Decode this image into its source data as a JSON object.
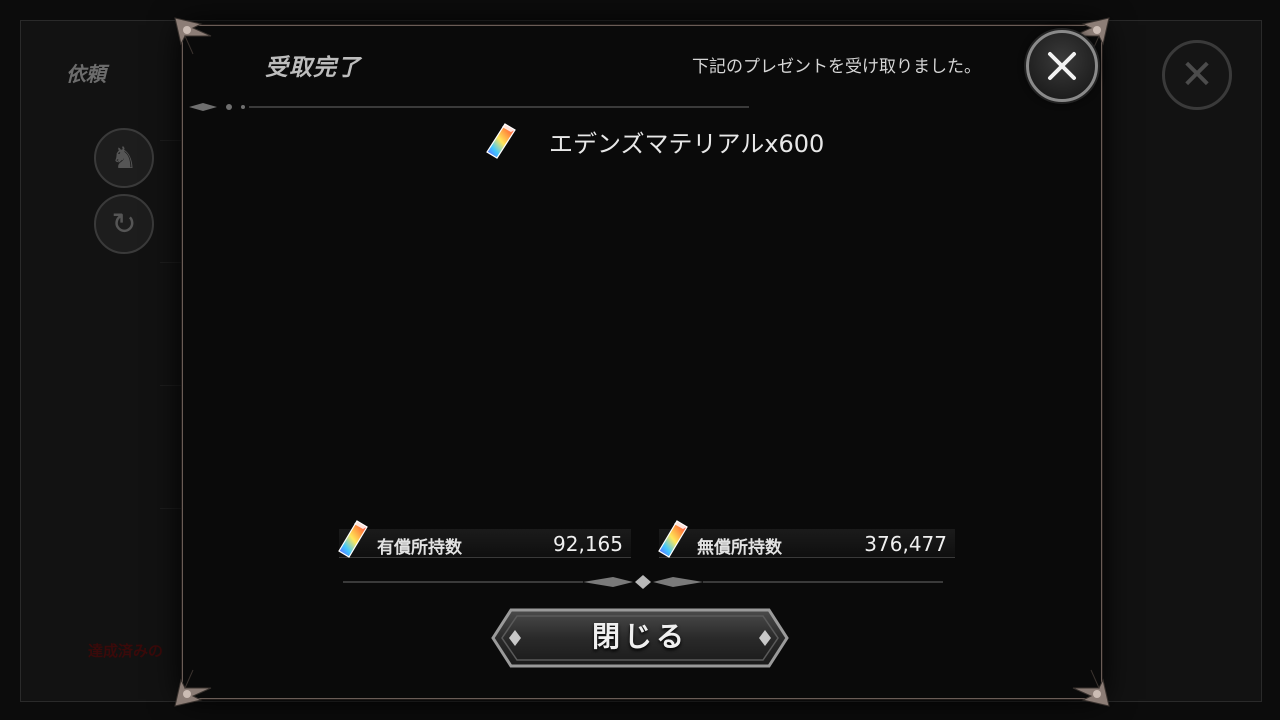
{
  "background": {
    "screen_title": "依頼",
    "footer_text": "達成済みの"
  },
  "dialog": {
    "title": "受取完了",
    "subtitle": "下記のプレゼントを受け取りました。",
    "close_icon": "close-x-icon",
    "reward": {
      "icon": "crystal-gem-icon",
      "text": "エデンズマテリアルx600"
    },
    "paid_count": {
      "label": "有償所持数",
      "value": "92,165"
    },
    "free_count": {
      "label": "無償所持数",
      "value": "376,477"
    },
    "ok_button": {
      "label": "閉じる"
    }
  },
  "colors": {
    "dialog_bg": "#0a0a0a",
    "frame": "#6a5c56",
    "text": "#e8e8e8"
  }
}
